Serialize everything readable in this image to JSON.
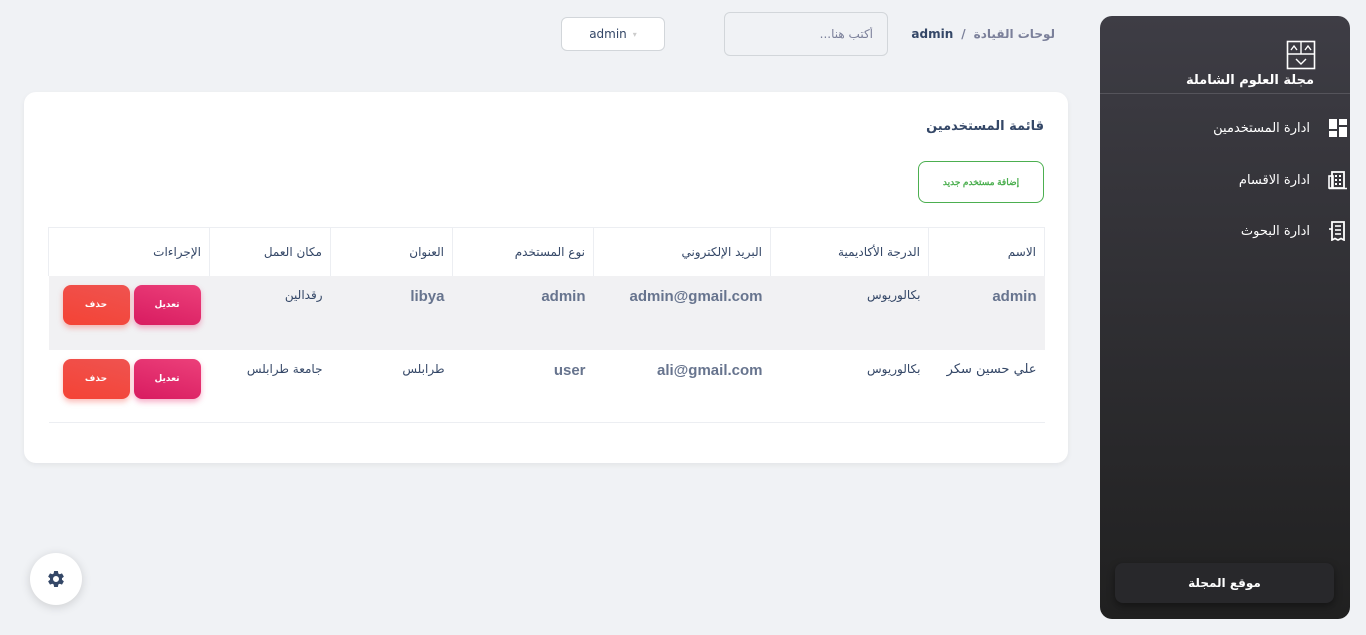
{
  "sidebar": {
    "brand_title": "مجلة العلوم الشاملة",
    "items": [
      {
        "label": "ادارة المستخدمين",
        "icon": "dashboard-icon"
      },
      {
        "label": "ادارة الاقسام",
        "icon": "building-icon"
      },
      {
        "label": "ادارة البحوث",
        "icon": "receipt-icon"
      }
    ],
    "site_button": "موقع المجلة"
  },
  "topbar": {
    "breadcrumb_parent": "لوحات القيادة",
    "breadcrumb_sep": "/",
    "breadcrumb_current": "admin",
    "search_placeholder": "أكتب هنا...",
    "user_name": "admin"
  },
  "card": {
    "title": "قائمة المستخدمين",
    "add_button": "إضافة مستخدم جديد"
  },
  "table": {
    "headers": [
      "الاسم",
      "الدرجة الأكاديمية",
      "البريد الإلكتروني",
      "نوع المستخدم",
      "العنوان",
      "مكان العمل",
      "الإجراءات"
    ],
    "rows": [
      {
        "name": "admin",
        "degree": "بكالوريوس",
        "email": "admin@gmail.com",
        "type": "admin",
        "address": "libya",
        "workplace": "رقدالين",
        "edit": "تعديل",
        "delete": "حذف"
      },
      {
        "name": "علي حسين سكر",
        "degree": "بكالوريوس",
        "email": "ali@gmail.com",
        "type": "user",
        "address": "طرابلس",
        "workplace": "جامعة طرابلس",
        "edit": "تعديل",
        "delete": "حذف"
      }
    ]
  },
  "colors": {
    "sidebar_top": "#3e3d45",
    "sidebar_bottom": "#202020",
    "edit_button": "#e91e63",
    "delete_button": "#f44335",
    "add_button_border": "#4caf50"
  }
}
